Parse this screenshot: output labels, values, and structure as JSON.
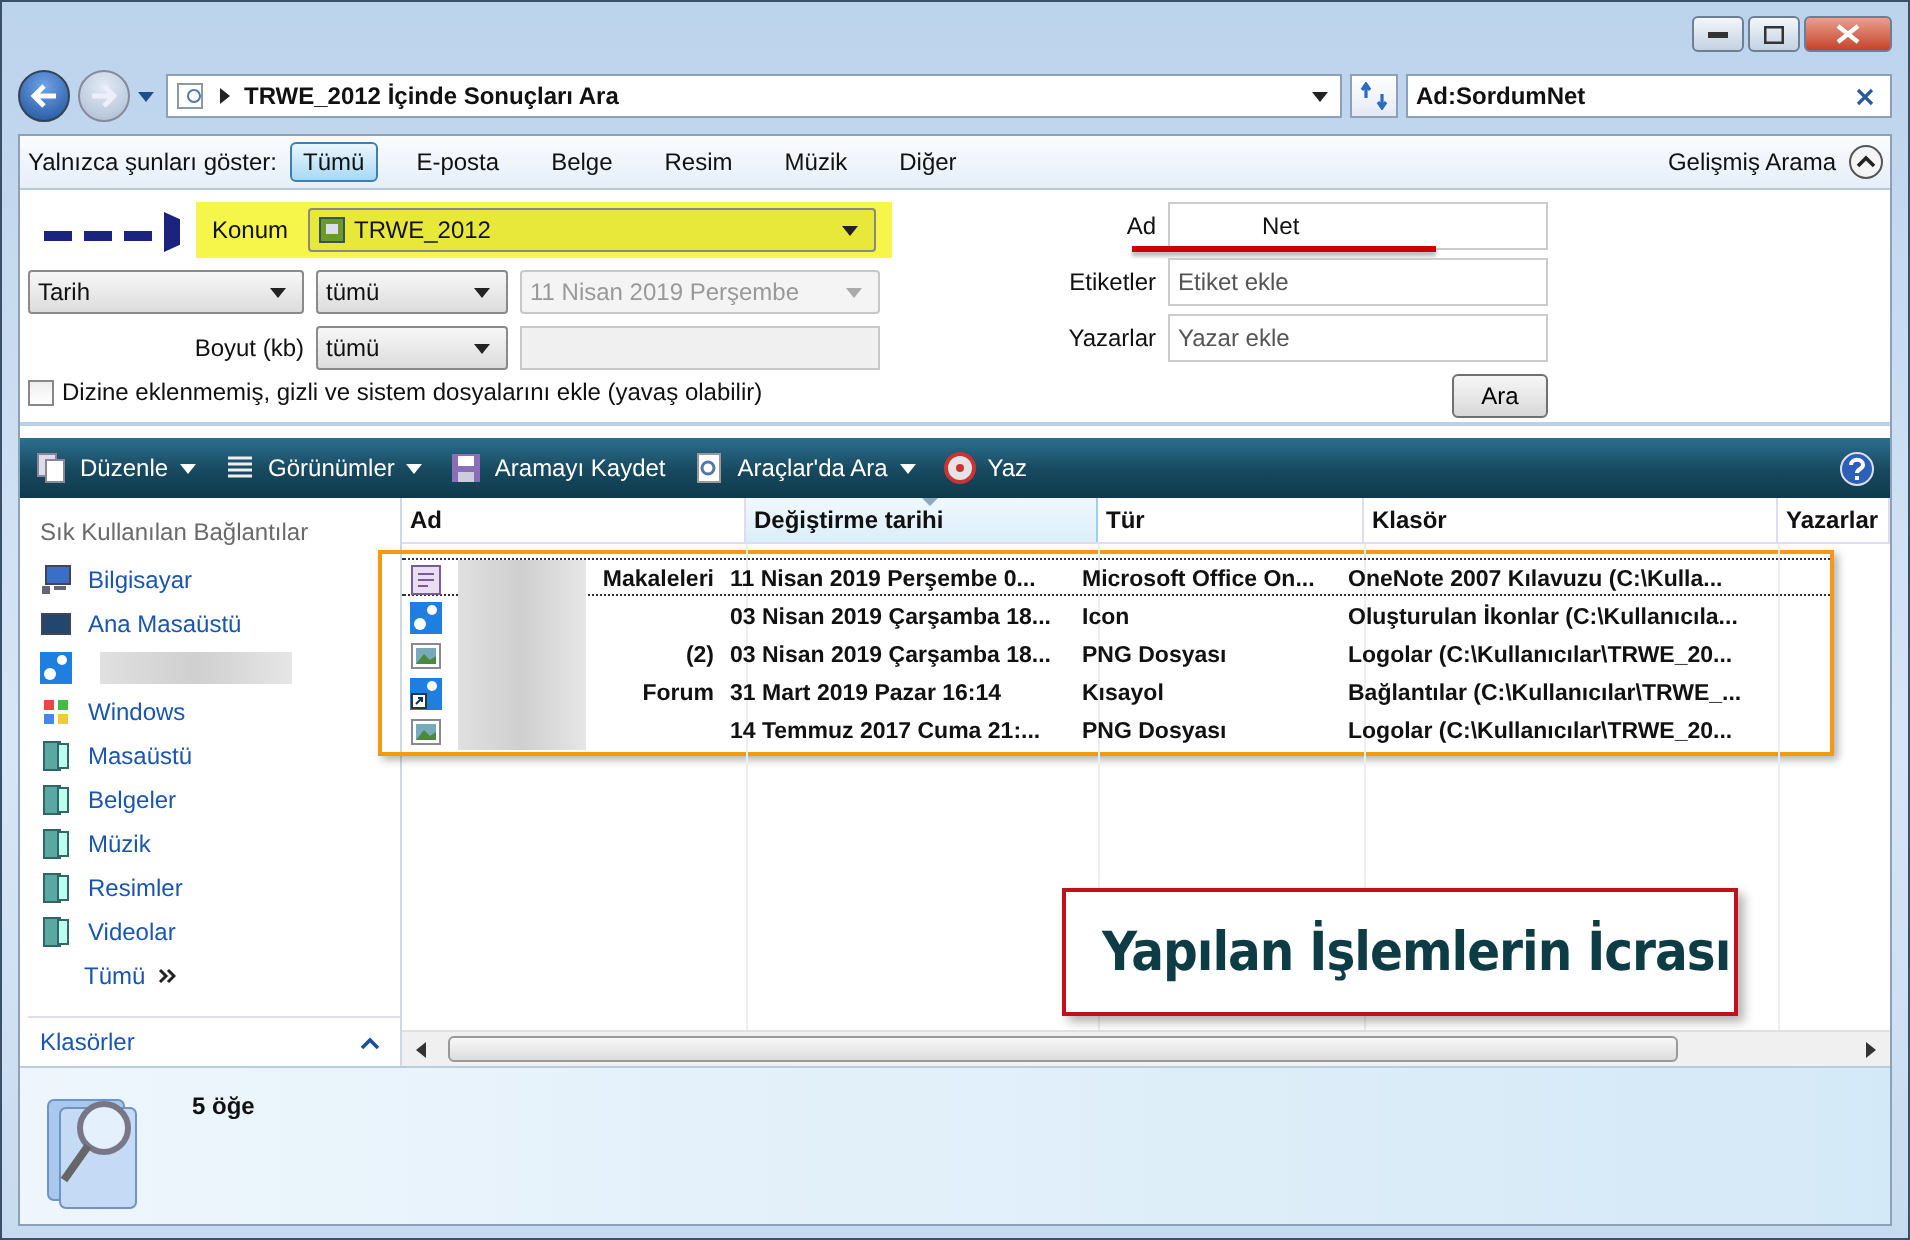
{
  "address_bar": {
    "path": "TRWE_2012 İçinde Sonuçları Ara"
  },
  "search_box": {
    "value": "Ad:SordumNet"
  },
  "filter_bar": {
    "label": "Yalnızca şunları göster:",
    "options": [
      {
        "label": "Tümü",
        "selected": true
      },
      {
        "label": "E-posta",
        "selected": false
      },
      {
        "label": "Belge",
        "selected": false
      },
      {
        "label": "Resim",
        "selected": false
      },
      {
        "label": "Müzik",
        "selected": false
      },
      {
        "label": "Diğer",
        "selected": false
      }
    ],
    "advanced": "Gelişmiş Arama"
  },
  "search_pane": {
    "location": {
      "label": "Konum",
      "value": "TRWE_2012"
    },
    "date": {
      "field": "Tarih",
      "range": "tümü",
      "value": "11 Nisan 2019 Perşembe",
      "disabled": true
    },
    "size": {
      "label": "Boyut (kb)",
      "range": "tümü",
      "disabled": true
    },
    "include_hidden": {
      "label": "Dizine eklenmemiş, gizli ve sistem dosyalarını ekle (yavaş olabilir)",
      "checked": false
    },
    "name": {
      "label": "Ad",
      "value": "Net"
    },
    "tags": {
      "label": "Etiketler",
      "placeholder": "Etiket ekle"
    },
    "authors": {
      "label": "Yazarlar",
      "placeholder": "Yazar ekle"
    },
    "search_button": "Ara"
  },
  "toolbar": [
    {
      "label": "Düzenle",
      "kind": "organize",
      "dropdown": true
    },
    {
      "label": "Görünümler",
      "kind": "views",
      "dropdown": true
    },
    {
      "label": "Aramayı Kaydet",
      "kind": "save",
      "dropdown": false
    },
    {
      "label": "Araçlar'da Ara",
      "kind": "search",
      "dropdown": true
    },
    {
      "label": "Yaz",
      "kind": "burn",
      "dropdown": false
    }
  ],
  "sidebar": {
    "heading": "Sık Kullanılan Bağlantılar",
    "items": [
      {
        "label": "Bilgisayar",
        "kind": "computer"
      },
      {
        "label": "Ana Masaüstü",
        "kind": "desktop"
      },
      {
        "kind": "gears"
      },
      {
        "label": "Windows",
        "kind": "windows"
      },
      {
        "label": "Masaüstü",
        "kind": "book"
      },
      {
        "label": "Belgeler",
        "kind": "book"
      },
      {
        "label": "Müzik",
        "kind": "book"
      },
      {
        "label": "Resimler",
        "kind": "book"
      },
      {
        "label": "Videolar",
        "kind": "book"
      },
      {
        "label": "Tümü",
        "kind": "more"
      }
    ],
    "folders": "Klasörler"
  },
  "table": {
    "columns": [
      {
        "label": "Ad",
        "sorted": false
      },
      {
        "label": "Değiştirme tarihi",
        "sorted": true
      },
      {
        "label": "Tür",
        "sorted": false
      },
      {
        "label": "Klasör",
        "sorted": false
      },
      {
        "label": "Yazarlar",
        "sorted": false
      }
    ],
    "rows": [
      {
        "name": "Makaleleri",
        "kind": "onenote",
        "modified": "11 Nisan 2019 Perşembe 0...",
        "type": "Microsoft Office On...",
        "folder": "OneNote 2007 Kılavuzu (C:\\Kulla...",
        "focused": true
      },
      {
        "kind": "gears",
        "modified": "03 Nisan 2019 Çarşamba 18...",
        "type": "Icon",
        "folder": "Oluşturulan İkonlar (C:\\Kullanıcıla...",
        "focused": false
      },
      {
        "name": "(2)",
        "kind": "image",
        "modified": "03 Nisan 2019 Çarşamba 18...",
        "type": "PNG Dosyası",
        "folder": "Logolar (C:\\Kullanıcılar\\TRWE_20...",
        "focused": false
      },
      {
        "name": "Forum",
        "kind": "shortcut",
        "modified": "31 Mart 2019 Pazar 16:14",
        "type": "Kısayol",
        "folder": "Bağlantılar (C:\\Kullanıcılar\\TRWE_...",
        "focused": false
      },
      {
        "kind": "image",
        "modified": "14 Temmuz 2017 Cuma 21:...",
        "type": "PNG Dosyası",
        "folder": "Logolar (C:\\Kullanıcılar\\TRWE_20...",
        "focused": false
      }
    ]
  },
  "details": {
    "count": "5 öğe"
  },
  "annotation": {
    "callout": "Yapılan İşlemlerin İcrası"
  }
}
